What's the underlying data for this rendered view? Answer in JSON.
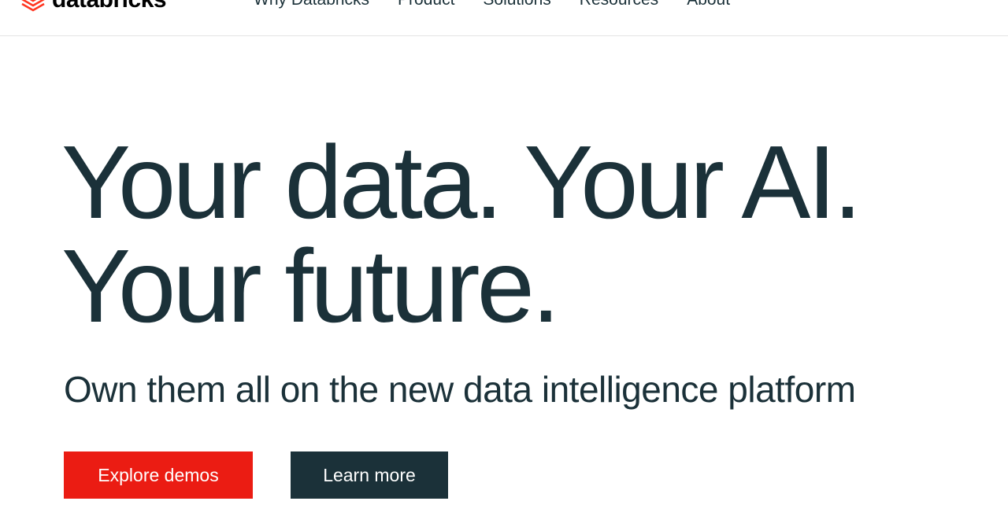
{
  "header": {
    "logo_text": "databricks",
    "nav": [
      "Why Databricks",
      "Product",
      "Solutions",
      "Resources",
      "About"
    ]
  },
  "hero": {
    "title_line1": "Your data. Your AI.",
    "title_line2": "Your future.",
    "subtitle": "Own them all on the new data intelligence platform",
    "primary_button": "Explore demos",
    "secondary_button": "Learn more"
  },
  "colors": {
    "brand_red": "#eb1c13",
    "navy": "#1b3139"
  }
}
